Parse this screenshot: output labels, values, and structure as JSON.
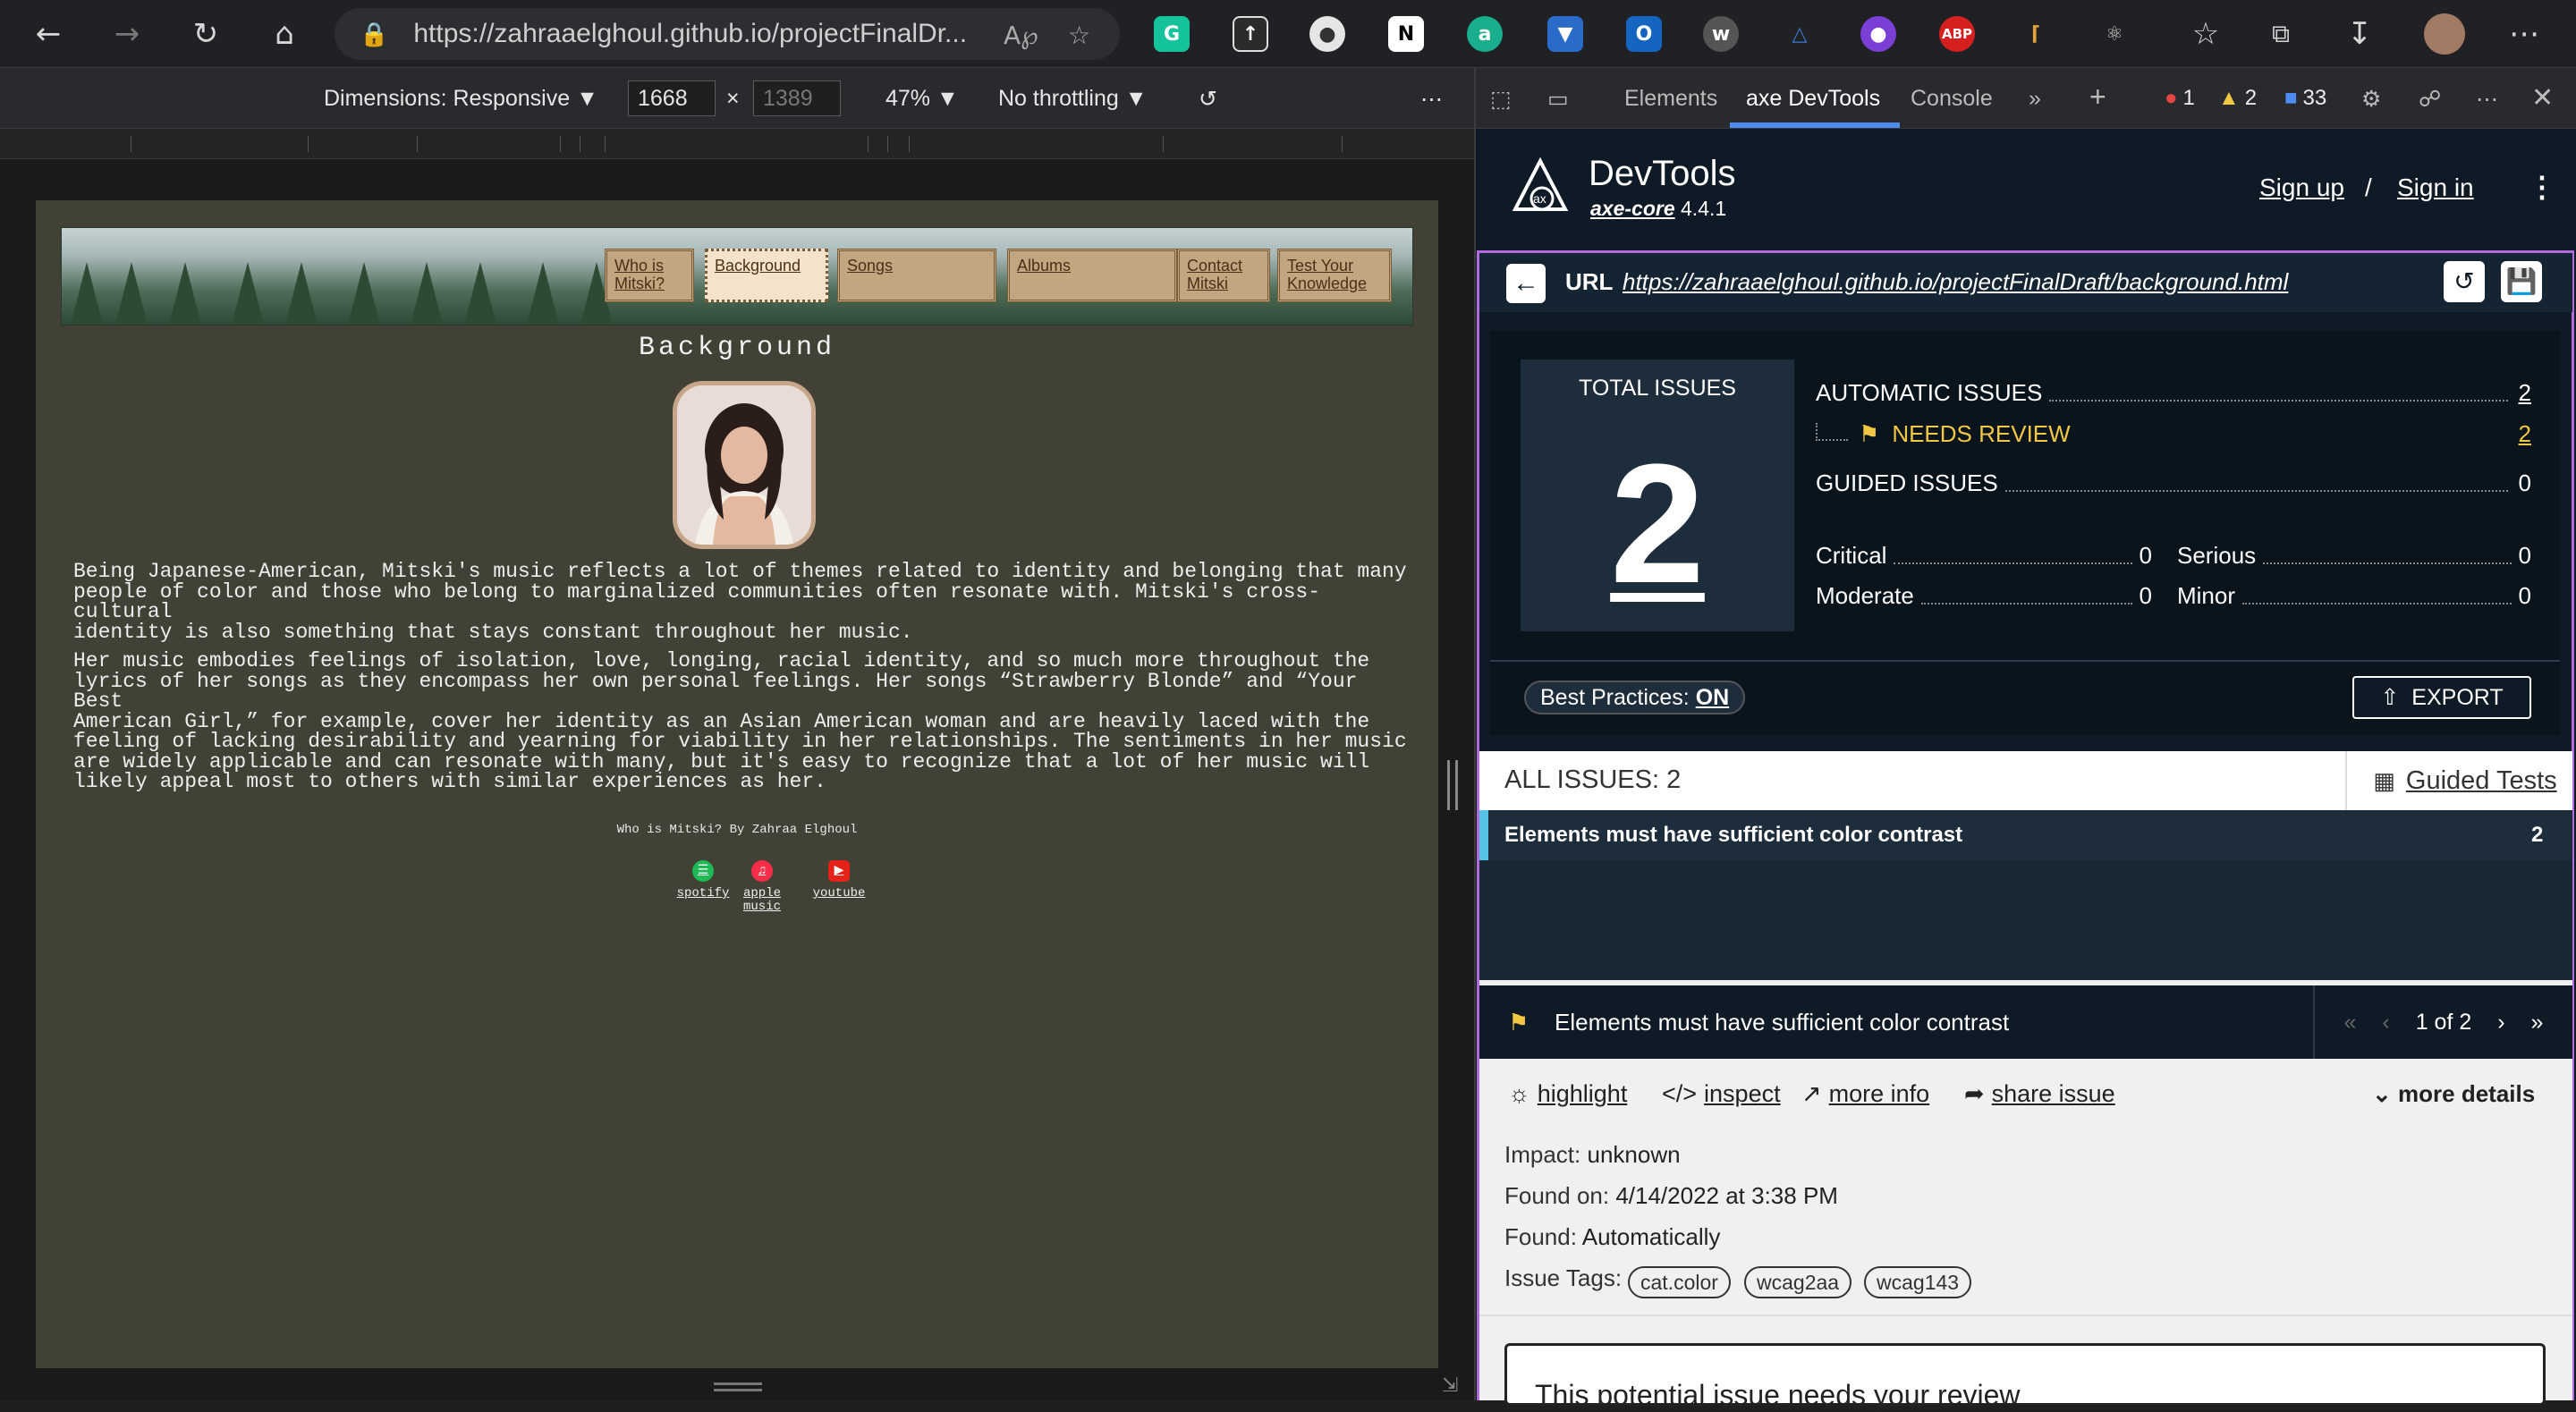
{
  "browser": {
    "url": "https://zahraaelghoul.github.io/projectFinalDr...",
    "extensions": [
      "grammarly-icon",
      "upload-icon",
      "profile-dot-icon",
      "notion-icon",
      "a-icon",
      "ext-blue-icon",
      "outlook-icon",
      "w-icon",
      "triangle-icon",
      "purple-circle-icon",
      "abp-icon",
      "tool-icon",
      "puzzle-icon"
    ],
    "abp_label": "ABP"
  },
  "device_toolbar": {
    "dimensions": "Dimensions: Responsive",
    "width": "1668",
    "height": "1389",
    "zoom": "47%",
    "throttling": "No throttling"
  },
  "site": {
    "nav": [
      "Who is Mitski?",
      "Background",
      "Songs",
      "Albums",
      "Contact Mitski",
      "Test Your Knowledge"
    ],
    "active_nav": "Background",
    "title": "Background",
    "para1": "Being Japanese-American, Mitski's music reflects a lot of themes related to identity and belonging that many\npeople of color and those who belong to marginalized communities often resonate with. Mitski's cross-cultural\nidentity is also something that stays constant throughout her music.",
    "para2": "Her music embodies feelings of isolation, love, longing, racial identity, and so much more throughout the\nlyrics of her songs as they encompass her own personal feelings. Her songs “Strawberry Blonde” and “Your Best\nAmerican Girl,” for example, cover her identity as an Asian American woman and are heavily laced with the\nfeeling of lacking desirability and yearning for viability in her relationships. The sentiments in her music\nare widely applicable and can resonate with many, but it's easy to recognize that a lot of her music will\nlikely appeal most to others with similar experiences as her.",
    "footer": "Who is Mitski? By Zahraa Elghoul",
    "social": [
      "spotify",
      "apple music",
      "youtube"
    ]
  },
  "devtools": {
    "tabs": [
      "Elements",
      "axe DevTools",
      "Console"
    ],
    "active_tab": "axe DevTools",
    "errors": "1",
    "warnings": "2",
    "messages": "33"
  },
  "axe": {
    "title": "DevTools",
    "core_name": "axe-core",
    "core_version": "4.4.1",
    "sign_up": "Sign up",
    "slash": "/",
    "sign_in": "Sign in",
    "url_label": "URL",
    "url": "https://zahraaelghoul.github.io/projectFinalDraft/background.html",
    "total_label": "TOTAL ISSUES",
    "total": "2",
    "automatic_label": "AUTOMATIC ISSUES",
    "automatic": "2",
    "needs_review_label": "NEEDS REVIEW",
    "needs_review": "2",
    "guided_label": "GUIDED ISSUES",
    "guided": "0",
    "critical_label": "Critical",
    "critical": "0",
    "serious_label": "Serious",
    "serious": "0",
    "moderate_label": "Moderate",
    "moderate": "0",
    "minor_label": "Minor",
    "minor": "0",
    "best_practices_label": "Best Practices:",
    "best_practices": "ON",
    "export": "EXPORT",
    "all_issues": "ALL ISSUES: 2",
    "guided_tests": "Guided Tests",
    "issue_title": "Elements must have sufficient color contrast",
    "issue_count": "2",
    "detail_title": "Elements must have sufficient color contrast",
    "pager": "1 of 2",
    "actions": {
      "highlight": "highlight",
      "inspect": "inspect",
      "more_info": "more info",
      "share_issue": "share issue",
      "more_details": "more details"
    },
    "impact_label": "Impact:",
    "impact": "unknown",
    "found_on_label": "Found on:",
    "found_on": "4/14/2022 at 3:38 PM",
    "found_label": "Found:",
    "found": "Automatically",
    "tags_label": "Issue Tags:",
    "tags": [
      "cat.color",
      "wcag2aa",
      "wcag143"
    ],
    "review_text": "This potential issue needs your review"
  }
}
